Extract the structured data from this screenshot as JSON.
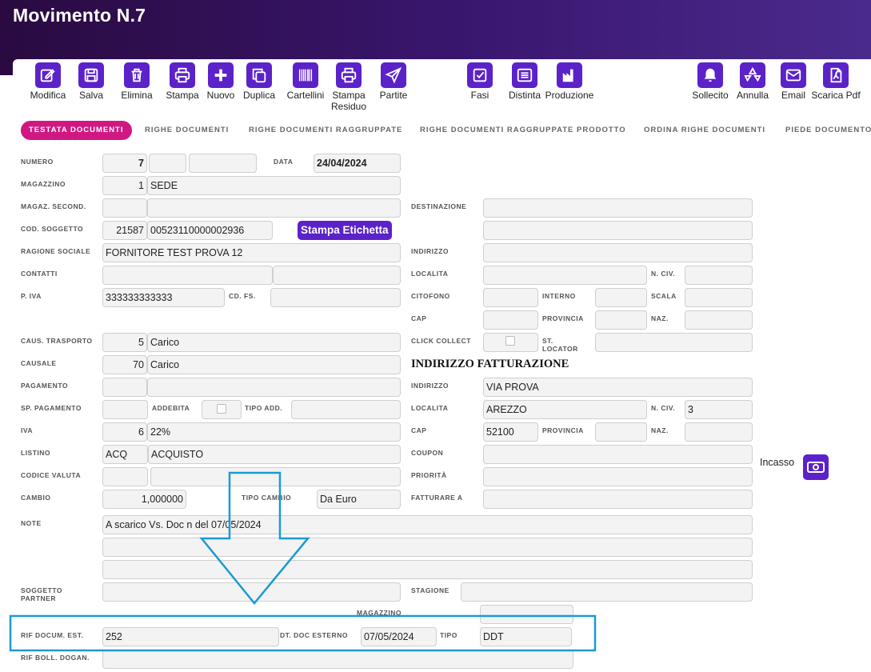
{
  "window": {
    "title": "Movimento N.7"
  },
  "toolbar": [
    {
      "name": "modifica",
      "label": "Modifica",
      "icon": "edit-icon"
    },
    {
      "name": "salva",
      "label": "Salva",
      "icon": "save-icon"
    },
    {
      "name": "elimina",
      "label": "Elimina",
      "icon": "trash-icon"
    },
    {
      "name": "stampa",
      "label": "Stampa",
      "icon": "printer-icon"
    },
    {
      "name": "nuovo",
      "label": "Nuovo",
      "icon": "plus-icon"
    },
    {
      "name": "duplica",
      "label": "Duplica",
      "icon": "copy-icon"
    },
    {
      "name": "cartellini",
      "label": "Cartellini",
      "icon": "barcode-icon"
    },
    {
      "name": "stampa-residuo",
      "label": "Stampa",
      "label2": "Residuo",
      "icon": "printer-icon"
    },
    {
      "name": "partite",
      "label": "Partite",
      "icon": "send-icon"
    },
    {
      "name": "fasi",
      "label": "Fasi",
      "icon": "checkbox-icon"
    },
    {
      "name": "distinta",
      "label": "Distinta",
      "icon": "list-icon"
    },
    {
      "name": "produzione",
      "label": "Produzione",
      "icon": "factory-icon"
    },
    {
      "name": "sollecito",
      "label": "Sollecito",
      "icon": "bell-icon"
    },
    {
      "name": "annulla",
      "label": "Annulla",
      "icon": "recycle-icon"
    },
    {
      "name": "email",
      "label": "Email",
      "icon": "mail-icon"
    },
    {
      "name": "scarica-pdf",
      "label": "Scarica Pdf",
      "icon": "pdf-icon"
    }
  ],
  "tabs": [
    {
      "label": "TESTATA DOCUMENTI",
      "active": true
    },
    {
      "label": "RIGHE DOCUMENTI"
    },
    {
      "label": "RIGHE DOCUMENTI RAGGRUPPATE"
    },
    {
      "label": "RIGHE DOCUMENTI RAGGRUPPATE PRODOTTO"
    },
    {
      "label": "ORDINA RIGHE DOCUMENTI"
    },
    {
      "label": "PIEDE DOCUMENTO"
    }
  ],
  "labels": {
    "numero": "NUMERO",
    "data": "DATA",
    "magazzino": "MAGAZZINO",
    "magaz_second": "MAGAZ. SECOND.",
    "destinazione": "DESTINAZIONE",
    "cod_soggetto": "COD. SOGGETTO",
    "ragione_sociale": "RAGIONE SOCIALE",
    "indirizzo": "INDIRIZZO",
    "contatti": "CONTATTI",
    "localita": "LOCALITA",
    "n_civ": "N. CIV.",
    "p_iva": "P. IVA",
    "cd_fs": "CD. FS.",
    "citofono": "CITOFONO",
    "interno": "INTERNO",
    "scala": "SCALA",
    "cap": "CAP",
    "provincia": "PROVINCIA",
    "naz": "NAZ.",
    "caus_trasporto": "CAUS. TRASPORTO",
    "click_collect": "CLICK COLLECT",
    "st_locator_1": "ST.",
    "st_locator_2": "LOCATOR",
    "causale": "CAUSALE",
    "pagamento": "PAGAMENTO",
    "sp_pagamento": "SP. PAGAMENTO",
    "addebita": "ADDEBITA",
    "tipo_add": "TIPO ADD.",
    "iva": "IVA",
    "listino": "LISTINO",
    "coupon": "COUPON",
    "codice_valuta": "CODICE VALUTA",
    "priorita": "PRIORITÀ",
    "cambio": "CAMBIO",
    "tipo_cambio": "TIPO CAMBIO",
    "fatturare_a": "FATTURARE A",
    "note": "NOTE",
    "soggetto_partner_1": "SOGGETTO",
    "soggetto_partner_2": "PARTNER",
    "stagione": "STAGIONE",
    "magazzino2": "MAGAZZINO",
    "rif_docum_est": "RIF DOCUM. EST.",
    "dt_doc_esterno": "DT. DOC ESTERNO",
    "tipo": "TIPO",
    "rif_boll_dogan": "RIF BOLL. DOGAN."
  },
  "section": {
    "indirizzo_fatturazione": "INDIRIZZO FATTURAZIONE"
  },
  "buttons": {
    "stampa_etichetta": "Stampa Etichetta",
    "incasso": "Incasso"
  },
  "values": {
    "numero": "7",
    "data": "24/04/2024",
    "magazzino_code": "1",
    "magazzino_name": "SEDE",
    "cod_soggetto": "21587",
    "cod_soggetto_ext": "00523110000002936",
    "ragione_sociale": "FORNITORE TEST PROVA 12",
    "p_iva": "333333333333",
    "caus_trasporto_code": "5",
    "caus_trasporto_name": "Carico",
    "causale_code": "70",
    "causale_name": "Carico",
    "iva_code": "6",
    "iva_name": "22%",
    "listino_code": "ACQ",
    "listino_name": "ACQUISTO",
    "cambio": "1,000000",
    "tipo_cambio": "Da Euro",
    "note": "A scarico Vs. Doc n      del 07/05/2024",
    "fatt_indirizzo": "VIA PROVA",
    "fatt_localita": "AREZZO",
    "fatt_n_civ": "3",
    "fatt_cap": "52100",
    "rif_docum_est": "252",
    "dt_doc_esterno": "07/05/2024",
    "tipo": "DDT"
  },
  "colors": {
    "accent": "#5b22c9",
    "tab_active": "#d11882",
    "highlight": "#1a9ad6"
  }
}
